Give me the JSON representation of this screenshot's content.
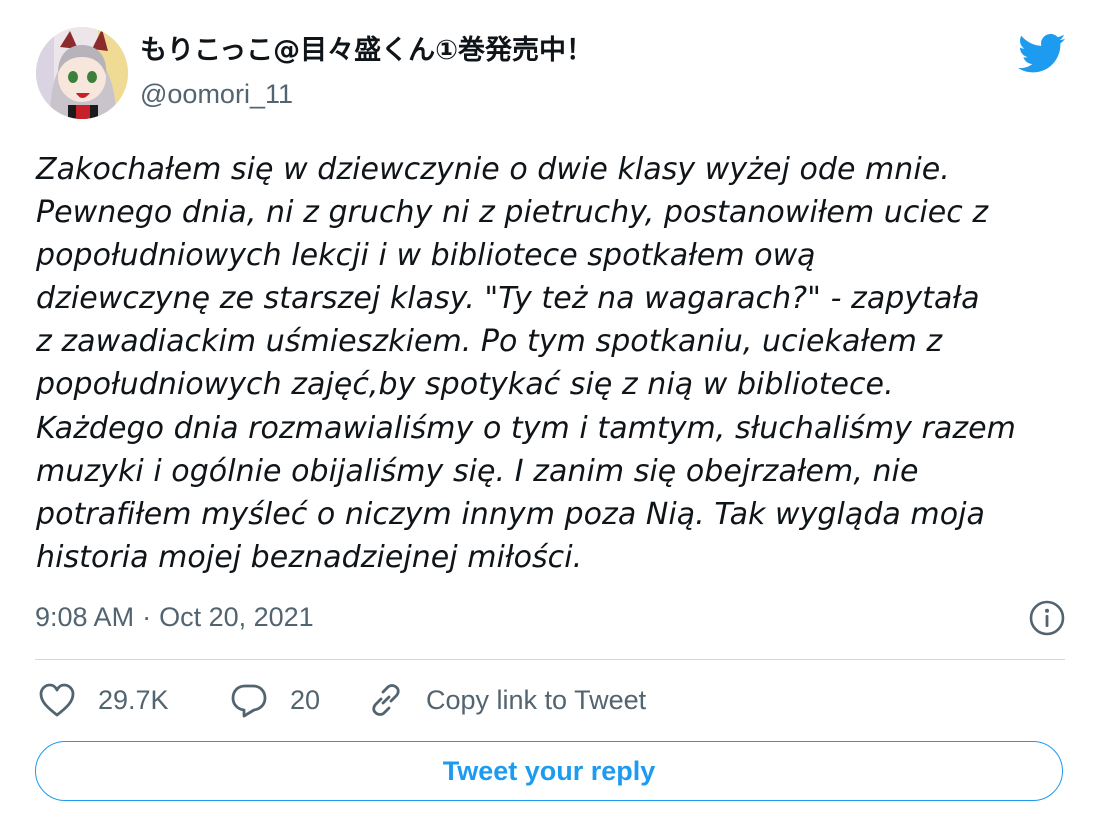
{
  "author": {
    "display_name": "もりこっこ@目々盛くん①巻発売中！",
    "handle": "@oomori_11",
    "avatar": "anime-character-avatar"
  },
  "brand": {
    "logo": "twitter-bird-icon",
    "accent_color": "#1d9bf0"
  },
  "tweet": {
    "text": "Zakochałem się w dziewczynie o dwie klasy wyżej ode mnie.\nPewnego dnia, ni z gruchy ni z pietruchy, postanowiłem uciec z\npopołudniowych lekcji i w bibliotece spotkałem ową\ndziewczynę ze starszej klasy. \"Ty też na wagarach?\" - zapytała\nz zawadiackim uśmieszkiem. Po tym spotkaniu, uciekałem z\npopołudniowych zajęć,by spotykać się z nią w bibliotece.\nKażdego dnia rozmawialiśmy o tym i tamtym, słuchaliśmy razem\nmuzyki i ogólnie obijaliśmy się. I zanim się obejrzałem, nie\npotrafiłem myśleć o niczym innym poza Nią. Tak wygląda moja\nhistoria mojej beznadziejnej miłości.",
    "time": "9:08 AM",
    "separator": "·",
    "date": "Oct 20, 2021"
  },
  "actions": {
    "likes": "29.7K",
    "replies": "20",
    "copy_link": "Copy link to Tweet",
    "like_icon": "heart-icon",
    "reply_icon": "speech-bubble-icon",
    "copy_icon": "link-icon",
    "info_icon": "info-icon"
  },
  "reply_button": {
    "label": "Tweet your reply"
  }
}
